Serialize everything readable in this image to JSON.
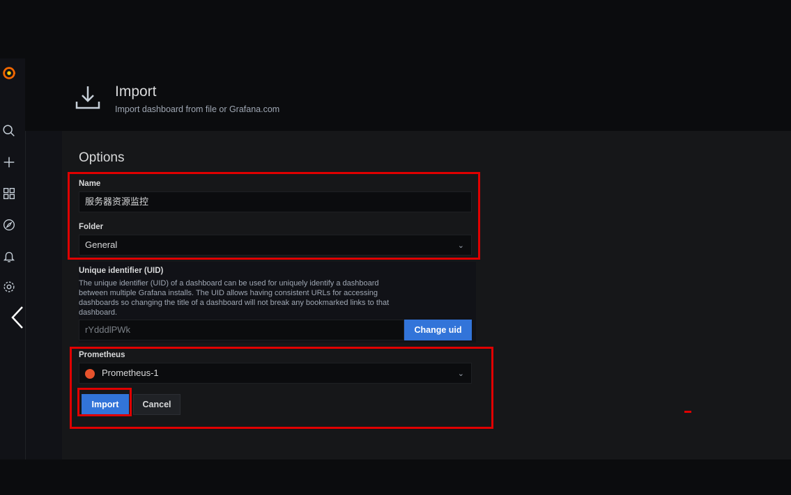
{
  "header": {
    "title": "Import",
    "subtitle": "Import dashboard from file or Grafana.com"
  },
  "sidebar": {
    "icons": [
      "grafana-logo-icon",
      "search-icon",
      "plus-icon",
      "dashboards-icon",
      "explore-icon",
      "alert-bell-icon",
      "gear-icon"
    ]
  },
  "options": {
    "title": "Options",
    "name_label": "Name",
    "name_value": "服务器资源监控",
    "folder_label": "Folder",
    "folder_value": "General",
    "uid_label": "Unique identifier (UID)",
    "uid_description": "The unique identifier (UID) of a dashboard can be used for uniquely identify a dashboard between multiple Grafana installs. The UID allows having consistent URLs for accessing dashboards so changing the title of a dashboard will not break any bookmarked links to that dashboard.",
    "uid_value": "rYdddlPWk",
    "change_uid_label": "Change uid",
    "datasource_label": "Prometheus",
    "datasource_value": "Prometheus-1",
    "import_label": "Import",
    "cancel_label": "Cancel"
  },
  "colors": {
    "accent": "#3274d9",
    "highlight": "#e00000",
    "grafana_orange": "#f46800"
  }
}
